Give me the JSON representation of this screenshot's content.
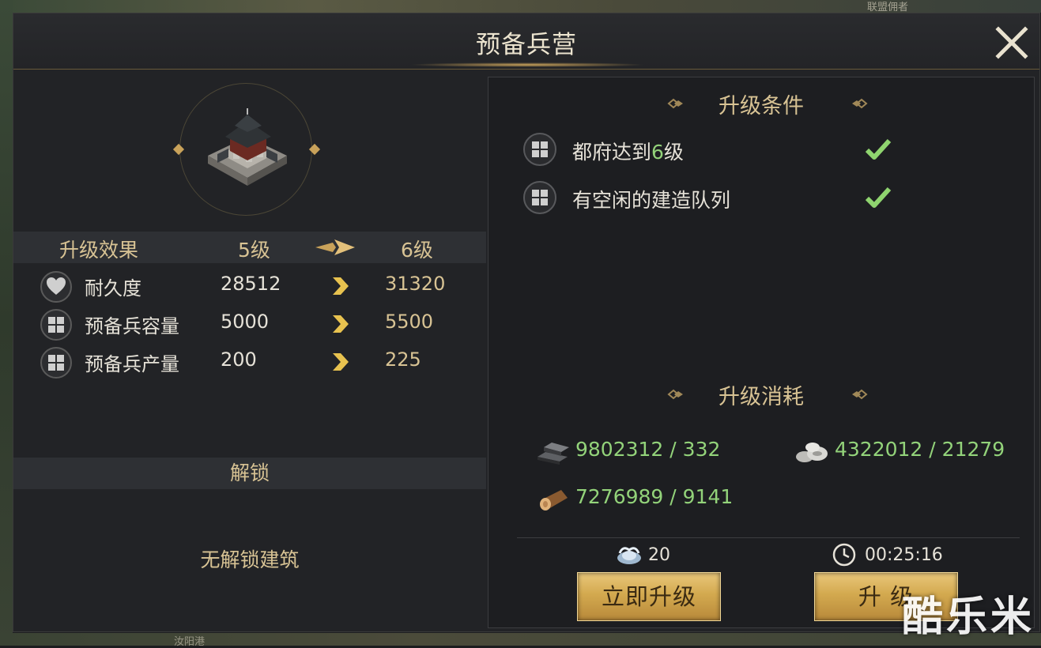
{
  "background": {
    "top_text": "联盟佣者",
    "bottom_text": "汝阳港"
  },
  "dialog": {
    "title": "预备兵营",
    "close_icon": "close-x-icon"
  },
  "effects": {
    "header_label": "升级效果",
    "current_level": "5级",
    "next_level": "6级",
    "rows": [
      {
        "icon": "heart-icon",
        "label": "耐久度",
        "current": "28512",
        "next": "31320"
      },
      {
        "icon": "grid-icon",
        "label": "预备兵容量",
        "current": "5000",
        "next": "5500"
      },
      {
        "icon": "grid-icon",
        "label": "预备兵产量",
        "current": "200",
        "next": "225"
      }
    ]
  },
  "unlock": {
    "header_label": "解锁",
    "empty_text": "无解锁建筑"
  },
  "conditions": {
    "title": "升级条件",
    "rows": [
      {
        "prefix": "都府达到",
        "highlight": "6",
        "suffix": "级",
        "met": true
      },
      {
        "prefix": "有空闲的建造队列",
        "highlight": "",
        "suffix": "",
        "met": true
      }
    ]
  },
  "consumption": {
    "title": "升级消耗",
    "resources": [
      {
        "icon": "iron-ingot-icon",
        "text": "9802312 / 332"
      },
      {
        "icon": "stone-icon",
        "text": "4322012 / 21279"
      },
      {
        "icon": "wood-log-icon",
        "text": "7276989 / 9141"
      }
    ]
  },
  "footer": {
    "instant_cost": "20",
    "instant_cost_icon": "silver-ingot-icon",
    "duration": "00:25:16",
    "duration_icon": "clock-icon",
    "instant_button": "立即升级",
    "upgrade_button": "升 级"
  },
  "watermark": "酷乐米",
  "colors": {
    "gold": "#d8c394",
    "green": "#93d37a",
    "panel": "#222326",
    "button": "#d3a94f"
  }
}
